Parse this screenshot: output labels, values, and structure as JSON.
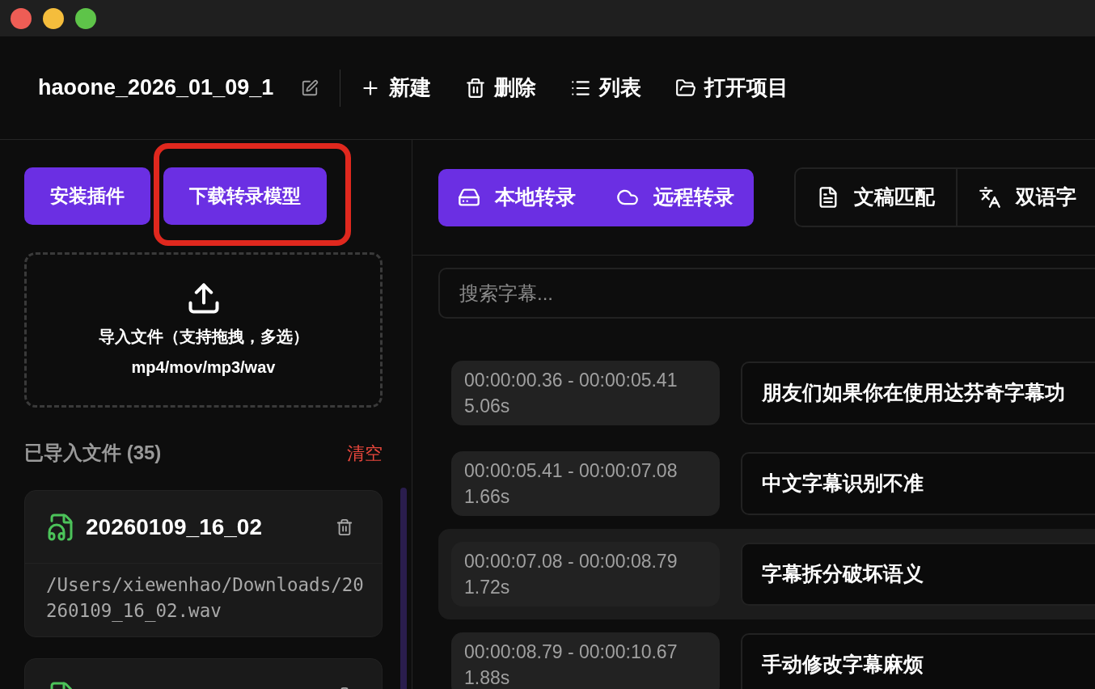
{
  "project": {
    "name": "haoone_2026_01_09_1"
  },
  "toolbar": [
    {
      "kind": "new",
      "label": "新建"
    },
    {
      "kind": "delete",
      "label": "删除"
    },
    {
      "kind": "list",
      "label": "列表"
    },
    {
      "kind": "open",
      "label": "打开项目"
    }
  ],
  "sidebar": {
    "buttons": [
      {
        "label": "安装插件",
        "highlighted": false
      },
      {
        "label": "下载转录模型",
        "highlighted": true
      }
    ],
    "dropzone": {
      "title": "导入文件（支持拖拽，多选）",
      "formats": "mp4/mov/mp3/wav"
    },
    "files_header": {
      "title": "已导入文件 (35)",
      "clear": "清空"
    },
    "files": [
      {
        "kind": "audio",
        "name": "20260109_16_02",
        "path": "/Users/xiewenhao/Downloads/20260109_16_02.wav"
      },
      {
        "kind": "audio"
      }
    ]
  },
  "modes": [
    {
      "kind": "local",
      "label": "本地转录"
    },
    {
      "kind": "remote",
      "label": "远程转录"
    }
  ],
  "tools": [
    {
      "kind": "document",
      "label": "文稿匹配"
    },
    {
      "kind": "translate",
      "label": "双语字"
    }
  ],
  "search": {
    "placeholder": "搜索字幕..."
  },
  "segments": [
    {
      "range": "00:00:00.36 - 00:00:05.41",
      "duration": "5.06s",
      "text": "朋友们如果你在使用达芬奇字幕功",
      "selected": false
    },
    {
      "range": "00:00:05.41 - 00:00:07.08",
      "duration": "1.66s",
      "text": "中文字幕识别不准",
      "selected": false
    },
    {
      "range": "00:00:07.08 - 00:00:08.79",
      "duration": "1.72s",
      "text": "字幕拆分破坏语义",
      "selected": true
    },
    {
      "range": "00:00:08.79 - 00:00:10.67",
      "duration": "1.88s",
      "text": "手动修改字幕麻烦",
      "selected": false
    }
  ]
}
